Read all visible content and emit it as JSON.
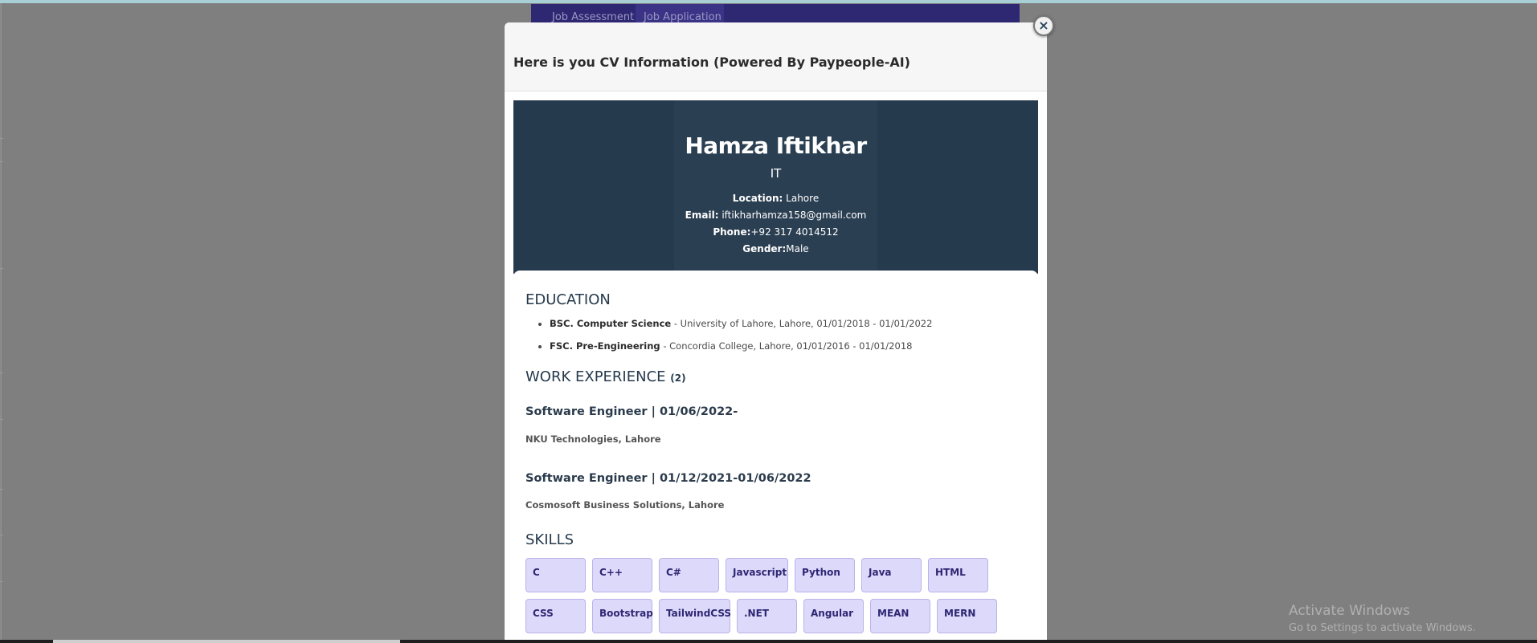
{
  "background_tabs": [
    "Job Assessment",
    "Job Application"
  ],
  "modal": {
    "title": "Here is you CV Information (Powered By Paypeople-AI)",
    "close_glyph": "×"
  },
  "cv": {
    "name": "Hamza Iftikhar",
    "role": "IT",
    "location_label": "Location:",
    "location": " Lahore",
    "email_label": "Email:",
    "email": " iftikharhamza158@gmail.com",
    "phone_label": "Phone:",
    "phone": "+92 317 4014512",
    "gender_label": "Gender:",
    "gender": "Male"
  },
  "education": {
    "title": "EDUCATION",
    "items": [
      {
        "degree": "BSC. Computer Science",
        "detail": " - University of Lahore, Lahore, 01/01/2018 - 01/01/2022"
      },
      {
        "degree": "FSC. Pre-Engineering",
        "detail": " - Concordia College, Lahore, 01/01/2016 - 01/01/2018"
      }
    ]
  },
  "work": {
    "title": "WORK EXPERIENCE",
    "count": "(2)",
    "jobs": [
      {
        "title": "Software Engineer | 01/06/2022-",
        "company": "NKU Technologies, Lahore"
      },
      {
        "title": "Software Engineer | 01/12/2021-01/06/2022",
        "company": "Cosmosoft Business Solutions, Lahore"
      }
    ]
  },
  "skills": {
    "title": "SKILLS",
    "items": [
      "C",
      "C++",
      "C#",
      "Javascript",
      "Python",
      "Java",
      "HTML",
      "CSS",
      "Bootstrap",
      "TailwindCSS",
      ".NET",
      "Angular",
      "MEAN",
      "MERN"
    ]
  },
  "watermark": {
    "line1": "Activate Windows",
    "line2": "Go to Settings to activate Windows."
  }
}
